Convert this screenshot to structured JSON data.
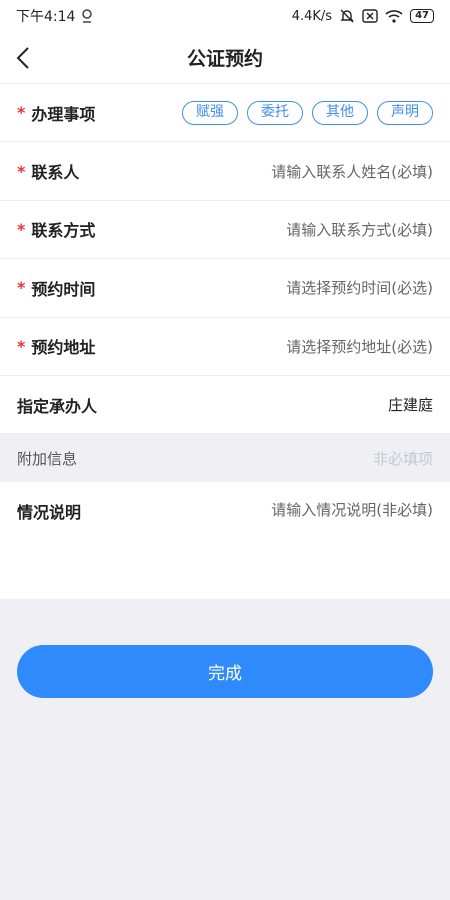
{
  "status": {
    "time": "下午4:14",
    "speed": "4.4K/s",
    "battery": "47"
  },
  "nav": {
    "title": "公证预约"
  },
  "form": {
    "required_mark": "*",
    "business": {
      "label": "办理事项",
      "options": [
        "赋强",
        "委托",
        "其他",
        "声明"
      ]
    },
    "contact": {
      "label": "联系人",
      "placeholder": "请输入联系人姓名(必填)"
    },
    "contact_method": {
      "label": "联系方式",
      "placeholder": "请输入联系方式(必填)"
    },
    "appointment_time": {
      "label": "预约时间",
      "placeholder": "请选择预约时间(必选)"
    },
    "appointment_address": {
      "label": "预约地址",
      "placeholder": "请选择预约地址(必选)"
    },
    "handler": {
      "label": "指定承办人",
      "value": "庄建庭"
    }
  },
  "extra": {
    "label": "附加信息",
    "hint": "非必填项"
  },
  "description": {
    "label": "情况说明",
    "placeholder": "请输入情况说明(非必填)"
  },
  "actions": {
    "done": "完成"
  },
  "colors": {
    "accent": "#2f8bfb",
    "required": "#e33333",
    "background": "#efeff4"
  }
}
